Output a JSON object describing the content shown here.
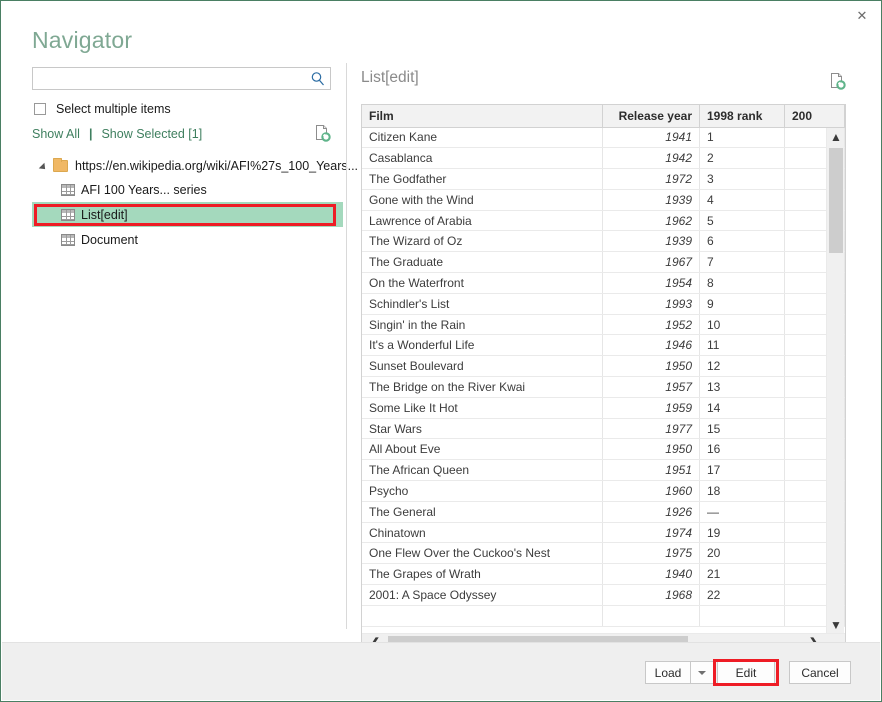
{
  "window": {
    "title": "Navigator",
    "close_label": "✕"
  },
  "left": {
    "search": {
      "value": "",
      "placeholder": "",
      "icon": "search-icon"
    },
    "select_multiple_label": "Select multiple items",
    "show_all_label": "Show All",
    "separator": "|",
    "show_selected_label": "Show Selected [1]",
    "refresh_icon": "refresh-document-icon",
    "tree": {
      "root": {
        "label": "https://en.wikipedia.org/wiki/AFI%27s_100_Years...",
        "icon": "folder-icon",
        "expanded": true
      },
      "children": [
        {
          "label": "AFI 100 Years... series",
          "icon": "table-grid-icon",
          "selected": false
        },
        {
          "label": "List[edit]",
          "icon": "table-grid-icon",
          "selected": true
        },
        {
          "label": "Document",
          "icon": "table-grid-icon",
          "selected": false
        }
      ]
    }
  },
  "right": {
    "preview_title": "List[edit]",
    "refresh_icon": "refresh-document-icon",
    "columns": [
      "Film",
      "Release year",
      "1998 rank",
      "200"
    ],
    "rows": [
      [
        "Citizen Kane",
        "1941",
        "1",
        ""
      ],
      [
        "Casablanca",
        "1942",
        "2",
        ""
      ],
      [
        "The Godfather",
        "1972",
        "3",
        ""
      ],
      [
        "Gone with the Wind",
        "1939",
        "4",
        ""
      ],
      [
        "Lawrence of Arabia",
        "1962",
        "5",
        ""
      ],
      [
        "The Wizard of Oz",
        "1939",
        "6",
        ""
      ],
      [
        "The Graduate",
        "1967",
        "7",
        ""
      ],
      [
        "On the Waterfront",
        "1954",
        "8",
        ""
      ],
      [
        "Schindler's List",
        "1993",
        "9",
        ""
      ],
      [
        "Singin' in the Rain",
        "1952",
        "10",
        ""
      ],
      [
        "It's a Wonderful Life",
        "1946",
        "11",
        ""
      ],
      [
        "Sunset Boulevard",
        "1950",
        "12",
        ""
      ],
      [
        "The Bridge on the River Kwai",
        "1957",
        "13",
        ""
      ],
      [
        "Some Like It Hot",
        "1959",
        "14",
        ""
      ],
      [
        "Star Wars",
        "1977",
        "15",
        ""
      ],
      [
        "All About Eve",
        "1950",
        "16",
        ""
      ],
      [
        "The African Queen",
        "1951",
        "17",
        ""
      ],
      [
        "Psycho",
        "1960",
        "18",
        ""
      ],
      [
        "The General",
        "1926",
        "—",
        ""
      ],
      [
        "Chinatown",
        "1974",
        "19",
        ""
      ],
      [
        "One Flew Over the Cuckoo's Nest",
        "1975",
        "20",
        ""
      ],
      [
        "The Grapes of Wrath",
        "1940",
        "21",
        ""
      ],
      [
        "2001: A Space Odyssey",
        "1968",
        "22",
        ""
      ],
      [
        "",
        "",
        "",
        ""
      ]
    ],
    "vscroll": {
      "up": "▲",
      "down": "▼"
    },
    "hscroll": {
      "left": "❮",
      "right": "❯"
    }
  },
  "footer": {
    "load_label": "Load",
    "load_dropdown_icon": "chevron-down-icon",
    "edit_label": "Edit",
    "cancel_label": "Cancel"
  },
  "colors": {
    "dialog_border": "#4a7f63",
    "title": "#7fa893",
    "link_green": "#3f7f5f",
    "selection_green": "#a4d9bd",
    "highlight_red": "#ee1c25",
    "footer_bg": "#efefef"
  }
}
